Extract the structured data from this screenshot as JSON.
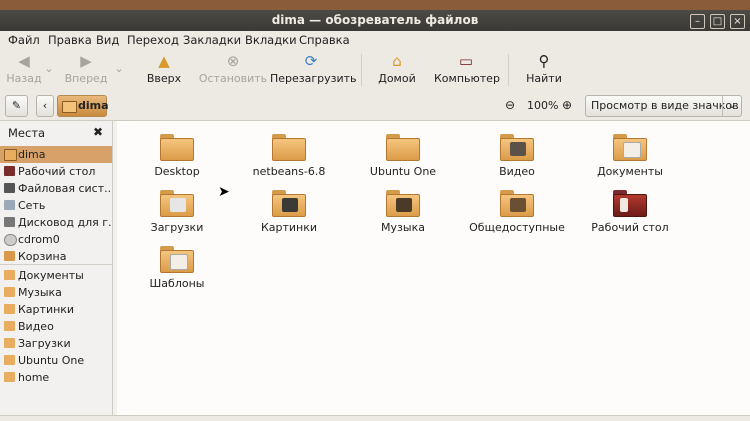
{
  "window": {
    "title": "dima — обозреватель файлов",
    "btn_minimize": "–",
    "btn_maximize": "□",
    "btn_close": "×"
  },
  "menu": [
    "Файл",
    "Правка",
    "Вид",
    "Переход",
    "Закладки",
    "Вкладки",
    "Справка"
  ],
  "toolbar": {
    "back": "Назад",
    "forward": "Вперед",
    "up": "Вверх",
    "stop": "Остановить",
    "reload": "Перезагрузить",
    "home": "Домой",
    "computer": "Компьютер",
    "search": "Найти"
  },
  "location": {
    "folder": "dima",
    "zoom": "100%",
    "view_mode": "Просмотр в виде значков"
  },
  "sidebar": {
    "header": "Места",
    "devices": [
      "dima",
      "Рабочий стол",
      "Файловая сист...",
      "Сеть",
      "Дисковод для г...",
      "cdrom0",
      "Корзина"
    ],
    "bookmarks": [
      "Документы",
      "Музыка",
      "Картинки",
      "Видео",
      "Загрузки",
      "Ubuntu One",
      "home"
    ]
  },
  "files": [
    "Desktop",
    "netbeans-6.8",
    "Ubuntu One",
    "Видео",
    "Документы",
    "Загрузки",
    "Картинки",
    "Музыка",
    "Общедоступные",
    "Рабочий стол",
    "Шаблоны"
  ],
  "colors": {
    "accent": "#d7a26a",
    "titlebar": "#3c3b37",
    "folder": "#e8ad5f"
  }
}
